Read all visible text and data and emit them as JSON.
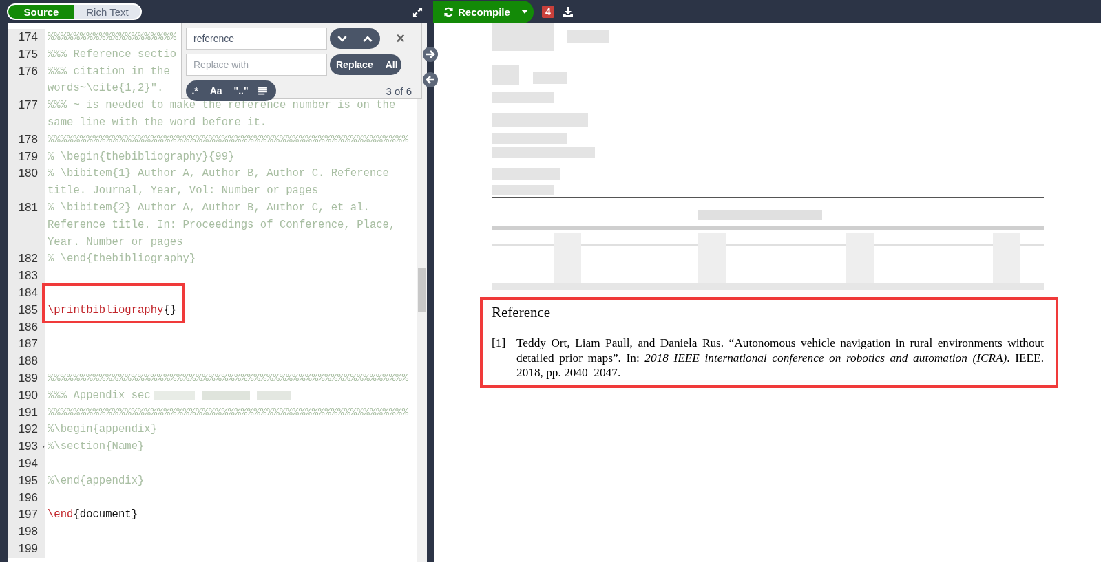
{
  "editor_toggle": [
    {
      "label": "Source",
      "selected": true
    },
    {
      "label": "Rich Text",
      "selected": false
    }
  ],
  "recompile": {
    "label": "Recompile"
  },
  "log_badge": "4",
  "editor": {
    "lines": [
      {
        "number": "174",
        "kind": "comment",
        "rows": [
          "%%%%%%%%%%%%%%%%%%%%"
        ]
      },
      {
        "number": "175",
        "kind": "comment",
        "rows": [
          "%%% Reference sectio"
        ]
      },
      {
        "number": "176",
        "kind": "comment",
        "rows": [
          "%%% citation in the",
          "words~\\cite{1,2}\"."
        ]
      },
      {
        "number": "177",
        "kind": "comment",
        "rows": [
          "%%% ~ is needed to make the reference number is on the",
          "same line with the word before it."
        ]
      },
      {
        "number": "178",
        "kind": "comment",
        "rows": [
          "%%%%%%%%%%%%%%%%%%%%%%%%%%%%%%%%%%%%%%%%%%%%%%%%%%%%%%%%"
        ]
      },
      {
        "number": "179",
        "kind": "comment",
        "rows": [
          "% \\begin{thebibliography}{99}"
        ]
      },
      {
        "number": "180",
        "kind": "comment",
        "rows": [
          "% \\bibitem{1} Author A, Author B, Author C. Reference",
          "title. Journal, Year, Vol: Number or pages"
        ]
      },
      {
        "number": "181",
        "kind": "comment",
        "rows": [
          "% \\bibitem{2} Author A, Author B, Author C, et al.",
          "Reference title. In: Proceedings of Conference, Place,",
          "Year. Number or pages"
        ]
      },
      {
        "number": "182",
        "kind": "comment",
        "rows": [
          "% \\end{thebibliography}"
        ]
      },
      {
        "number": "183",
        "kind": "blank"
      },
      {
        "number": "184",
        "kind": "blank"
      },
      {
        "number": "185",
        "kind": "code",
        "segments": [
          {
            "kind": "command",
            "text": "\\printbibliography"
          },
          {
            "kind": "text",
            "text": "{}"
          }
        ]
      },
      {
        "number": "186",
        "kind": "blank"
      },
      {
        "number": "187",
        "kind": "blank"
      },
      {
        "number": "188",
        "kind": "blank"
      },
      {
        "number": "189",
        "kind": "comment",
        "rows": [
          "%%%%%%%%%%%%%%%%%%%%%%%%%%%%%%%%%%%%%%%%%%%%%%%%%%%%%%%%"
        ]
      },
      {
        "number": "190",
        "kind": "comment",
        "rows": [
          "%%% Appendix sec"
        ],
        "blurred": true
      },
      {
        "number": "191",
        "kind": "comment",
        "rows": [
          "%%%%%%%%%%%%%%%%%%%%%%%%%%%%%%%%%%%%%%%%%%%%%%%%%%%%%%%%"
        ]
      },
      {
        "number": "192",
        "kind": "comment",
        "rows": [
          "%\\begin{appendix}"
        ]
      },
      {
        "number": "193",
        "kind": "comment",
        "rows": [
          "%\\section{Name}"
        ],
        "fold": "▾"
      },
      {
        "number": "194",
        "kind": "blank"
      },
      {
        "number": "195",
        "kind": "comment",
        "rows": [
          "%\\end{appendix}"
        ]
      },
      {
        "number": "196",
        "kind": "blank"
      },
      {
        "number": "197",
        "kind": "code",
        "segments": [
          {
            "kind": "command",
            "text": "\\end"
          },
          {
            "kind": "text",
            "text": "{document}"
          }
        ]
      },
      {
        "number": "198",
        "kind": "blank"
      },
      {
        "number": "199",
        "kind": "blank"
      }
    ]
  },
  "find_panel": {
    "search_value": "reference",
    "replace_placeholder": "Replace with",
    "replace_label": "Replace",
    "replace_all_label": "All",
    "options": [
      ".*",
      "Aa",
      "\"..\""
    ],
    "close": "×",
    "match_count": "3 of 6"
  },
  "pdf": {
    "references_heading": "Reference",
    "entries": [
      {
        "label": "[1]",
        "text": "Teddy Ort, Liam Paull, and Daniela Rus. “Autonomous vehicle navigation in rural environments without detailed prior maps”. In: *2018 IEEE international conference on robotics and automation (ICRA)*. IEEE. 2018, pp. 2040–2047."
      }
    ]
  }
}
